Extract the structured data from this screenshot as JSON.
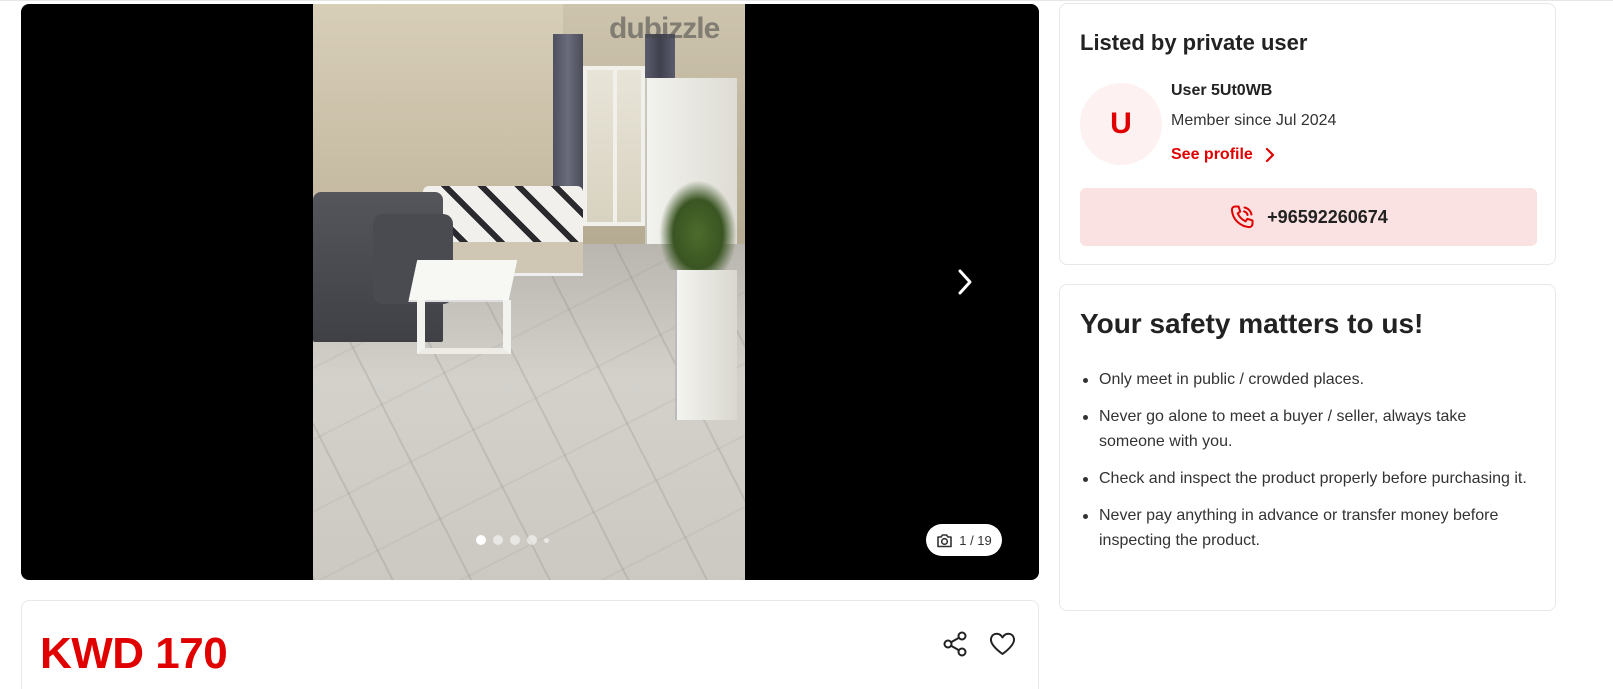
{
  "gallery": {
    "watermark": "dubizzle",
    "counter": "1 / 19",
    "current_image": 1,
    "total_images": 19,
    "dots": 5,
    "icons": {
      "next": "chevron-right-icon",
      "counter": "camera-icon"
    }
  },
  "listing": {
    "price": "KWD 170",
    "icons": {
      "share": "share-icon",
      "favorite": "heart-icon"
    }
  },
  "seller": {
    "title": "Listed by private user",
    "avatar_initial": "U",
    "name": "User 5Ut0WB",
    "member_since": "Member since Jul 2024",
    "see_profile": "See profile",
    "phone": "+96592260674"
  },
  "safety": {
    "title": "Your safety matters to us!",
    "tips": [
      "Only meet in public / crowded places.",
      "Never go alone to meet a buyer / seller, always take someone with you.",
      "Check and inspect the product properly before purchasing it.",
      "Never pay anything in advance or transfer money before inspecting the product."
    ]
  },
  "colors": {
    "brand_red": "#e00000",
    "phone_button_bg": "#fbe2e2",
    "avatar_bg": "#fdf1f1",
    "gallery_bg": "#000000"
  }
}
